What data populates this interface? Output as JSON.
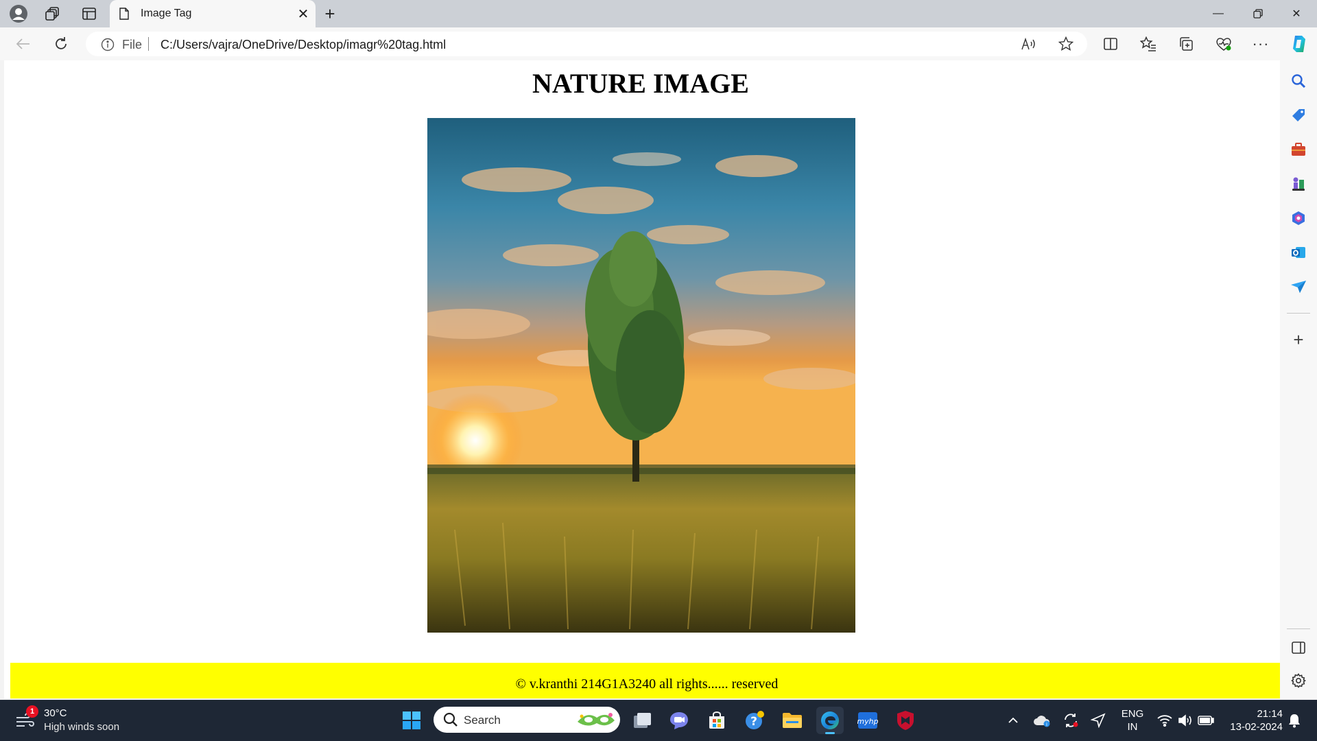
{
  "browser": {
    "tab": {
      "title": "Image Tag"
    },
    "address": {
      "scheme_label": "File",
      "url": "C:/Users/vajra/OneDrive/Desktop/imagr%20tag.html"
    }
  },
  "page": {
    "heading": "NATURE IMAGE",
    "image": {
      "subject": "tree in grass field at sunset",
      "alt": ""
    },
    "footer": {
      "text": "© v.kranthi 214G1A3240 all rights...... reserved",
      "background": "#ffff00"
    }
  },
  "taskbar": {
    "weather": {
      "temperature": "30°C",
      "description": "High winds soon",
      "badge": "1"
    },
    "search": {
      "placeholder": "Search"
    },
    "language": {
      "line1": "ENG",
      "line2": "IN"
    },
    "clock": {
      "time": "21:14",
      "date": "13-02-2024"
    }
  },
  "colors": {
    "taskbar": "#1e2735",
    "footer": "#ffff00",
    "page": "#ffffff",
    "titlebar": "#ccd0d6"
  }
}
